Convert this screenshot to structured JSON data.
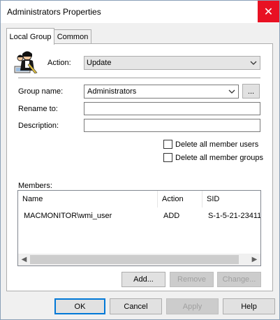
{
  "window": {
    "title": "Administrators Properties",
    "close_glyph": "✕"
  },
  "tabs": [
    {
      "label": "Local Group"
    },
    {
      "label": "Common"
    }
  ],
  "form": {
    "action_label": "Action:",
    "action_value": "Update",
    "group_name_label": "Group name:",
    "group_name_value": "Administrators",
    "browse_label": "...",
    "rename_label": "Rename to:",
    "rename_value": "",
    "description_label": "Description:",
    "description_value": "",
    "delete_users_label": "Delete all member users",
    "delete_groups_label": "Delete all member groups"
  },
  "members": {
    "label": "Members:",
    "columns": [
      "Name",
      "Action",
      "SID"
    ],
    "rows": [
      {
        "name": "MACMONITOR\\wmi_user",
        "action": "ADD",
        "sid": "S-1-5-21-23411"
      }
    ],
    "add_label": "Add...",
    "remove_label": "Remove",
    "change_label": "Change..."
  },
  "buttons": {
    "ok": "OK",
    "cancel": "Cancel",
    "apply": "Apply",
    "help": "Help"
  },
  "icons": {
    "group_icon": "users-icon"
  },
  "colors": {
    "close_bg": "#e81123",
    "default_border": "#0078d7"
  }
}
